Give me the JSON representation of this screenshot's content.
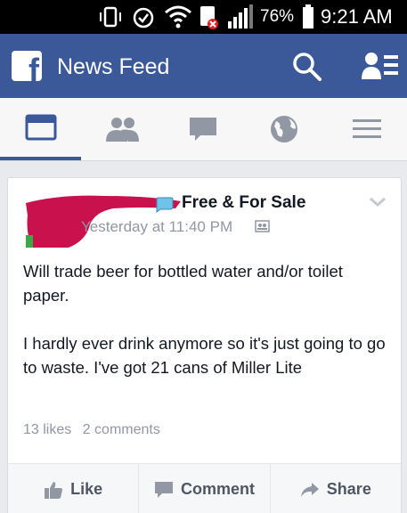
{
  "status_bar": {
    "battery_percent": "76%",
    "time": "9:21 AM"
  },
  "header": {
    "title": "News Feed",
    "logo": "facebook-logo",
    "search_icon": "search-icon",
    "friend_requests_icon": "friend-requests-icon",
    "color": "#3b5998"
  },
  "tabs": [
    {
      "icon": "news-feed-icon",
      "active": true
    },
    {
      "icon": "friends-icon",
      "active": false
    },
    {
      "icon": "messages-icon",
      "active": false
    },
    {
      "icon": "globe-icon",
      "active": false
    },
    {
      "icon": "menu-icon",
      "active": false
    }
  ],
  "post": {
    "group_name": "Free & For Sale",
    "timestamp": "Yesterday at 11:40 PM",
    "paragraphs": [
      "Will trade beer for bottled water and/or toilet paper.",
      "I hardly ever drink anymore so it's just going to go to waste. I've got 21 cans of Miller Lite"
    ],
    "likes": "13 likes",
    "comments": "2 comments",
    "actions": {
      "like": "Like",
      "comment": "Comment",
      "share": "Share"
    }
  }
}
